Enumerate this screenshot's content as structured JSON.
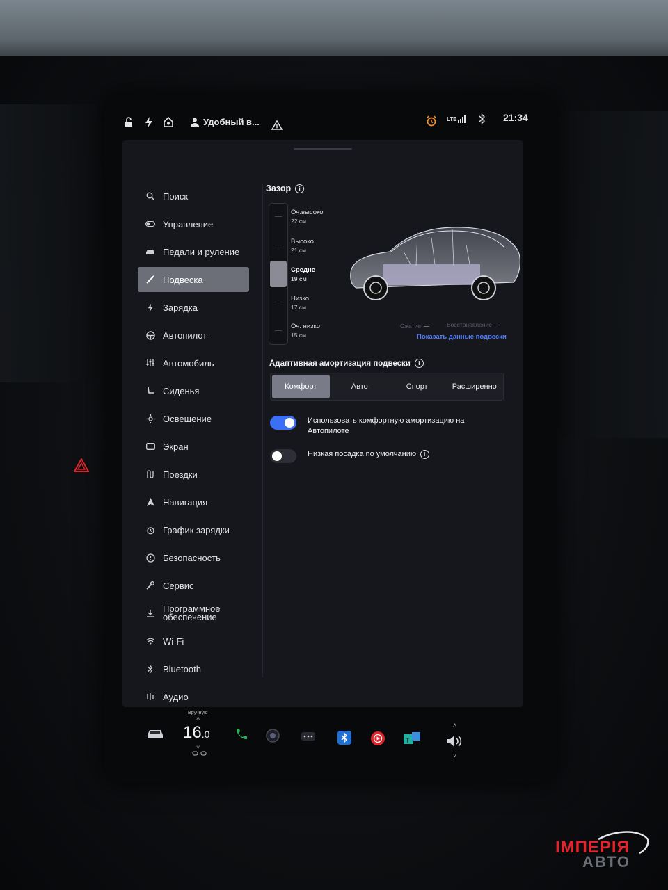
{
  "status_bar": {
    "icons": [
      "lock-open-icon",
      "bolt-icon",
      "homelink-icon",
      "person-icon",
      "alert-triangle-icon",
      "alarm-icon",
      "lte-signal-icon",
      "bluetooth-icon"
    ],
    "profile_name": "Удобный в...",
    "network": "LTE",
    "time": "21:34"
  },
  "sidebar": {
    "items": [
      {
        "label": "Поиск",
        "icon": "search-icon"
      },
      {
        "label": "Управление",
        "icon": "toggle-icon"
      },
      {
        "label": "Педали и руление",
        "icon": "car-icon"
      },
      {
        "label": "Подвеска",
        "icon": "wrench-icon",
        "active": true
      },
      {
        "label": "Зарядка",
        "icon": "bolt-icon"
      },
      {
        "label": "Автопилот",
        "icon": "steering-wheel-icon"
      },
      {
        "label": "Автомобиль",
        "icon": "sliders-icon"
      },
      {
        "label": "Сиденья",
        "icon": "seat-icon"
      },
      {
        "label": "Освещение",
        "icon": "sun-icon"
      },
      {
        "label": "Экран",
        "icon": "display-icon"
      },
      {
        "label": "Поездки",
        "icon": "trips-icon"
      },
      {
        "label": "Навигация",
        "icon": "navigation-icon"
      },
      {
        "label": "График зарядки",
        "icon": "alarm-clock-icon"
      },
      {
        "label": "Безопасность",
        "icon": "shield-info-icon"
      },
      {
        "label": "Сервис",
        "icon": "wrench-service-icon"
      },
      {
        "label": "Программное обеспечение",
        "icon": "download-icon"
      },
      {
        "label": "Wi-Fi",
        "icon": "wifi-icon"
      },
      {
        "label": "Bluetooth",
        "icon": "bluetooth-icon"
      },
      {
        "label": "Аудио",
        "icon": "audio-icon"
      }
    ]
  },
  "suspension": {
    "title": "Зазор",
    "ride_height_fraction_selected": 0.5,
    "levels": [
      {
        "name": "Оч.высоко",
        "value": "22 см"
      },
      {
        "name": "Высоко",
        "value": "21 см"
      },
      {
        "name": "Средне",
        "value": "19 см",
        "selected": true
      },
      {
        "name": "Низко",
        "value": "17 см"
      },
      {
        "name": "Оч. низко",
        "value": "15 см"
      }
    ],
    "legend_compression": "Сжатие",
    "legend_rebound": "Восстановление",
    "show_data_link": "Показать данные подвески",
    "adaptive_title": "Адаптивная амортизация подвески",
    "modes": [
      "Комфорт",
      "Авто",
      "Спорт",
      "Расширенно"
    ],
    "active_mode": "Комфорт",
    "toggles": [
      {
        "label": "Использовать комфортную амортизацию на Автопилоте",
        "on": true
      },
      {
        "label": "Низкая посадка по умолчанию",
        "on": false
      }
    ]
  },
  "dock": {
    "temp_mode": "Вручную",
    "temp_whole": "16",
    "temp_decimal": ".0",
    "icons": [
      "car-icon",
      "phone-icon",
      "camera-icon",
      "more-icon",
      "bluetooth-app-icon",
      "music-app-icon",
      "tidal-app-icon",
      "volume-icon"
    ]
  },
  "watermark": {
    "line1": "ІМПЕРІЯ",
    "line2": "АВТО"
  },
  "colors": {
    "accent_blue": "#3b6ff5",
    "link_blue": "#4d7cff",
    "active_nav": "#6c6e78",
    "alarm_orange": "#f08a24",
    "watermark_red": "#e4232b"
  }
}
